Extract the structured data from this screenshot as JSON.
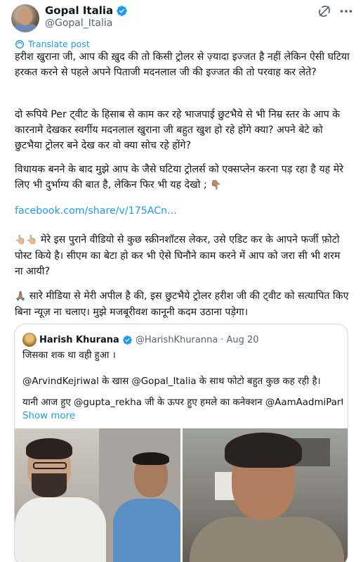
{
  "author": {
    "display_name": "Gopal Italia",
    "handle": "@Gopal_Italia",
    "verified_icon": "verified-badge-icon",
    "brand_color": "#1d9bf0"
  },
  "actions": {
    "grok_icon": "grok-icon",
    "more_icon": "more-icon"
  },
  "translate_label": "Translate post",
  "post": {
    "p1": "हरीश खुराना जी, आप की ख़ुद की तो किसी ट्रोलर से ज़्यादा इज्जत है नहीं लेकिन ऐसी घटिया हरकत करने से पहले अपने पिताजी मदनलाल जी की इज्जत की तो परवाह कर लेते?",
    "p2": "दो रूपिये Per ट्वीट के हिसाब से काम कर रहे भाजपाई छुटभैये से भी निम्र स्तर के आप के कारनामे देखकर स्वर्गीय मदनलाल खुराना जी बहुत खुश हो रहे होंगे क्या?  अपने बेटे को छुटभैया ट्रोलर बने देख कर वो क्या सोच रहे होंगे?",
    "p3": "विधायक बनने के बाद मुझे आप के जैसे घटिया ट्रोलर्स को एक्सप्लेन करना पड़ रहा है यह मेरे लिए भी दुर्भाग्य की बात है, लेकिन फिर भी यह देखो ;",
    "p3_emoji": "👇🏽",
    "link": "facebook.com/share/v/175ACn...",
    "p5_emoji": "👆🏼👆🏼",
    "p5": " मेरे इस पुराने वीडियो से कुछ स्क्रीनशॉटस लेकर, उसे एडिट कर के आपने फर्जी फ़ोटो पोस्ट किये है। सीएम का बेटा हो कर भी ऐसे घिनौने काम करने में आप को जरा सी भी शरम ना आयी?",
    "p6_emoji": "🙏🏽",
    "p6": " सारे मीडिया से मेरी अपील है की, इस छुटभैये ट्रोलर हरीश जी की ट्वीट को सत्यापित किए बिना न्यूज़ ना चलाए। मुझे मजबूरीवश कानूनी कदम उठाना पड़ेगा।"
  },
  "quote": {
    "display_name": "Harish Khurana",
    "handle": "@HarishKhuranna",
    "separator": "·",
    "date": "Aug 20",
    "line1": "जिसका शक था वही हुआ ।",
    "line2": "@ArvindKejriwal के खास @Gopal_Italia के साथ फोटो बहुत कुछ कह रही है।",
    "line3": "यानी आज हुए @gupta_rekha जी के ऊपर हुए हमले का कनेक्शन @AamAadmiParty से ...",
    "show_more": "Show more"
  }
}
